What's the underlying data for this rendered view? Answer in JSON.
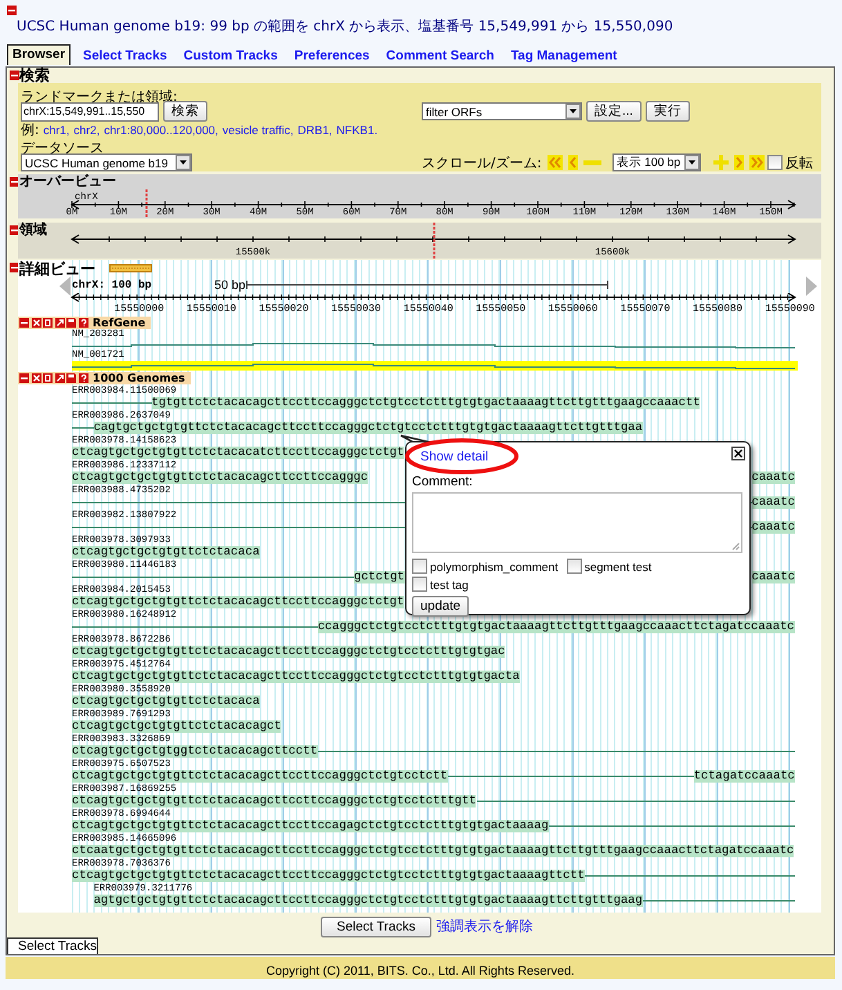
{
  "title": "UCSC Human genome b19: 99 bp の範囲を chrX から表示、塩基番号 15,549,991 から 15,550,090",
  "tabs": [
    {
      "label": "Browser",
      "selected": true
    },
    {
      "label": "Select Tracks",
      "selected": false
    },
    {
      "label": "Custom Tracks",
      "selected": false
    },
    {
      "label": "Preferences",
      "selected": false
    },
    {
      "label": "Comment Search",
      "selected": false
    },
    {
      "label": "Tag Management",
      "selected": false
    }
  ],
  "search": {
    "heading": "検索",
    "landmark_label": "ランドマークまたは領域:",
    "position": "chrX:15,549,991..15,550",
    "search_button": "検索",
    "example_label": "例:",
    "examples": [
      "chr1,",
      "chr2,",
      "chr1:80,000..120,000,",
      "vesicle traffic,",
      "DRB1,",
      "NFKB1."
    ],
    "data_source_label": "データソース",
    "data_source": "UCSC Human genome b19",
    "filter": "filter ORFs",
    "settings_button": "設定...",
    "run_button": "実行",
    "scroll_label": "スクロール/ズーム:",
    "zoom": "表示 100 bp",
    "reverse": {
      "label": "反転",
      "checked": false
    }
  },
  "overview": {
    "heading": "オーバービュー",
    "chromosome": "chrX",
    "ticks": [
      "0M",
      "10M",
      "20M",
      "30M",
      "40M",
      "50M",
      "60M",
      "70M",
      "80M",
      "90M",
      "100M",
      "110M",
      "120M",
      "130M",
      "140M",
      "150M"
    ]
  },
  "region": {
    "heading": "領域",
    "ticks": [
      "15500k",
      "15600k"
    ]
  },
  "detail": {
    "heading": "詳細ビュー",
    "position": "chrX: 100 bp",
    "scale": "50 bp",
    "ticks": [
      "15550000",
      "15550010",
      "15550020",
      "15550030",
      "15550040",
      "15550050",
      "15550060",
      "15550070",
      "15550080",
      "15550090"
    ],
    "tracks": [
      {
        "name": "RefGene",
        "kind": "genes",
        "items": [
          {
            "name": "NM_203281",
            "highlighted": false
          },
          {
            "name": "NM_001721",
            "highlighted": true
          }
        ]
      },
      {
        "name": "1000 Genomes",
        "kind": "reads",
        "items": [
          {
            "name": "ERR003984.11500069",
            "segments": [
              "tgtgttctctacacagcttccttccagggctctgtcctctttgtgtgactaaaagttcttgtttgaagccaaactt"
            ]
          },
          {
            "name": "ERR003986.2637049",
            "segments": [
              "cagtgctgctgtgttctctacacagcttccttccagggctctgtcctctttgtgtgactaaaagttcttgtttgaa"
            ]
          },
          {
            "name": "ERR003978.14158623",
            "segments": [
              "ctcagtgctgctgtgttctctacacatcttccttccagggctctgt"
            ]
          },
          {
            "name": "ERR003986.12337112",
            "segments": [
              "ctcagtgctgctgtgttctctacacagcttccttccagggc",
              "caaatc"
            ]
          },
          {
            "name": "ERR003988.4735202",
            "segments": [
              "caaatc"
            ]
          },
          {
            "name": "ERR003982.13807922",
            "segments": [
              "caaatc"
            ]
          },
          {
            "name": "ERR003978.3097933",
            "segments": [
              "ctcagtgctgctgtgttctctacaca"
            ]
          },
          {
            "name": "ERR003980.11446183",
            "segments": [
              "gctctgt",
              "caaatc"
            ]
          },
          {
            "name": "ERR003984.2015453",
            "segments": [
              "ctcagtgctgctgtgttctctacacagcttccttccagggctctgt"
            ]
          },
          {
            "name": "ERR003980.16248912",
            "segments": [
              "ccagggctctgtcctctttgtgtgactaaaagttcttgtttgaagccaaacttctagatccaaatc"
            ]
          },
          {
            "name": "ERR003978.8672286",
            "segments": [
              "ctcagtgctgctgtgttctctacacagcttccttccagggctctgtcctctttgtgtgac"
            ]
          },
          {
            "name": "ERR003975.4512764",
            "segments": [
              "ctcagtgctgctgtgttctctacacagcttccttccagggctctgtcctctttgtgtgacta"
            ]
          },
          {
            "name": "ERR003980.3558920",
            "segments": [
              "ctcagtgctgctgtgttctctacaca"
            ]
          },
          {
            "name": "ERR003989.7691293",
            "segments": [
              "ctcagtgctgctgtgttctctacacagct"
            ]
          },
          {
            "name": "ERR003983.3326869",
            "segments": [
              "ctcagtgctgctgtggtctctacacagcttcctt"
            ]
          },
          {
            "name": "ERR003975.6507523",
            "segments": [
              "ctcagtgctgctgtgttctctacacagcttccttccagggctctgtcctctt",
              "tctagatccaaatc"
            ]
          },
          {
            "name": "ERR003987.16869255",
            "segments": [
              "ctcagtgctgctgtgttctctacacagcttccttccagggctctgtcctctttgtt"
            ]
          },
          {
            "name": "ERR003978.6994644",
            "segments": [
              "ctcagtgctgctgtgttctctacacagcttccttccagagctctgtcctctttgtgtgactaaaag"
            ]
          },
          {
            "name": "ERR003985.14665096",
            "segments": [
              "ctcaatgctgctgtgttctctacacagcttccttccagggctctgtcctctttgtgtgactaaaagttcttgtttgaagccaaacttctagatccaaatc"
            ]
          },
          {
            "name": "ERR003978.7036376",
            "segments": [
              "ctcagtgctgctgtgttctctacacagcttccttccagggctctgtcctctttgtgtgactaaaagttctt"
            ]
          },
          {
            "name": "ERR003979.3211776",
            "segments": [
              "agtgctgctgtgttctctacacagcttccttccagggctctgtcctctttgtgtgactaaaagttcttgtttgaag"
            ]
          }
        ]
      }
    ]
  },
  "popup": {
    "link": "Show detail",
    "comment_label": "Comment:",
    "tags": [
      {
        "label": "polymorphism_comment",
        "checked": false
      },
      {
        "label": "segment test",
        "checked": false
      },
      {
        "label": "test tag",
        "checked": false
      }
    ],
    "update_button": "update"
  },
  "bottom": {
    "select_button": "Select Tracks",
    "clear_link": "強調表示を解除",
    "tab": "Select Tracks"
  },
  "footer": "Copyright (C) 2011, BITS. Co., Ltd. All Rights Reserved."
}
